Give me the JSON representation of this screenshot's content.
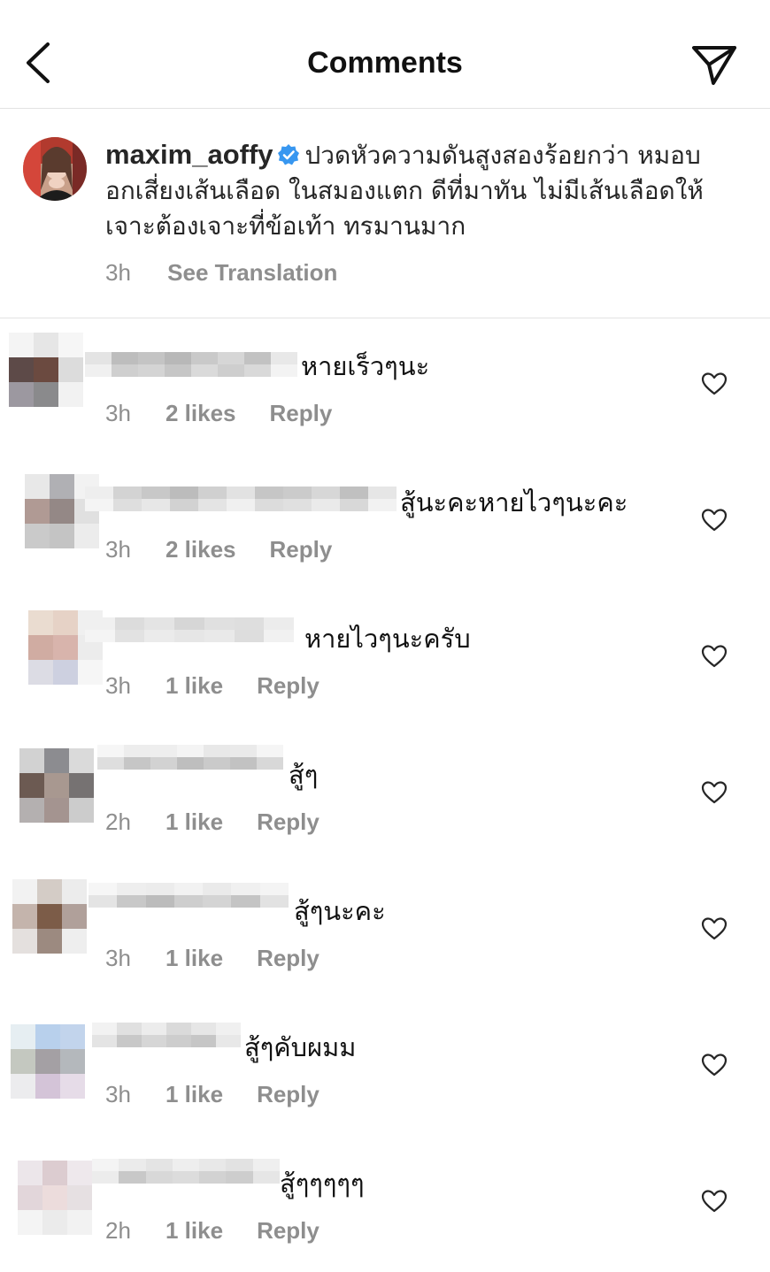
{
  "header": {
    "title": "Comments",
    "back_icon": "chevron-left-icon",
    "share_icon": "paper-plane-icon"
  },
  "caption": {
    "username": "maxim_aoffy",
    "verified_icon": "verified-badge-icon",
    "text_line1": "ปวดหัวความดันสูงสองร้อยกว่า หมอบ",
    "text_line2": "อกเสี่ยงเส้นเลือด ในสมองแตก ดีที่มาทัน ไม่มีเส้นเลือดให้",
    "text_line3": "เจาะต้องเจาะที่ข้อเท้า ทรมานมาก",
    "time": "3h",
    "see_translation": "See Translation"
  },
  "comments": [
    {
      "text": "หายเร็วๆนะ",
      "time": "3h",
      "likes": "2 likes",
      "reply": "Reply"
    },
    {
      "text": "สู้นะคะหายไวๆนะคะ",
      "time": "3h",
      "likes": "2 likes",
      "reply": "Reply"
    },
    {
      "text": "หายไวๆนะครับ",
      "time": "3h",
      "likes": "1 like",
      "reply": "Reply"
    },
    {
      "text": "สู้ๆ",
      "time": "2h",
      "likes": "1 like",
      "reply": "Reply"
    },
    {
      "text": "สู้ๆนะคะ",
      "time": "3h",
      "likes": "1 like",
      "reply": "Reply"
    },
    {
      "text": "สู้ๆคับผมม",
      "time": "3h",
      "likes": "1 like",
      "reply": "Reply"
    },
    {
      "text": "สู้ๆๆๆๆๆ",
      "time": "2h",
      "likes": "1 like",
      "reply": "Reply"
    }
  ],
  "like_icon": "heart-outline-icon",
  "colors": {
    "text": "#262626",
    "meta": "#8e8e8e",
    "divider": "#e3e3e3",
    "verified": "#3897f0"
  }
}
